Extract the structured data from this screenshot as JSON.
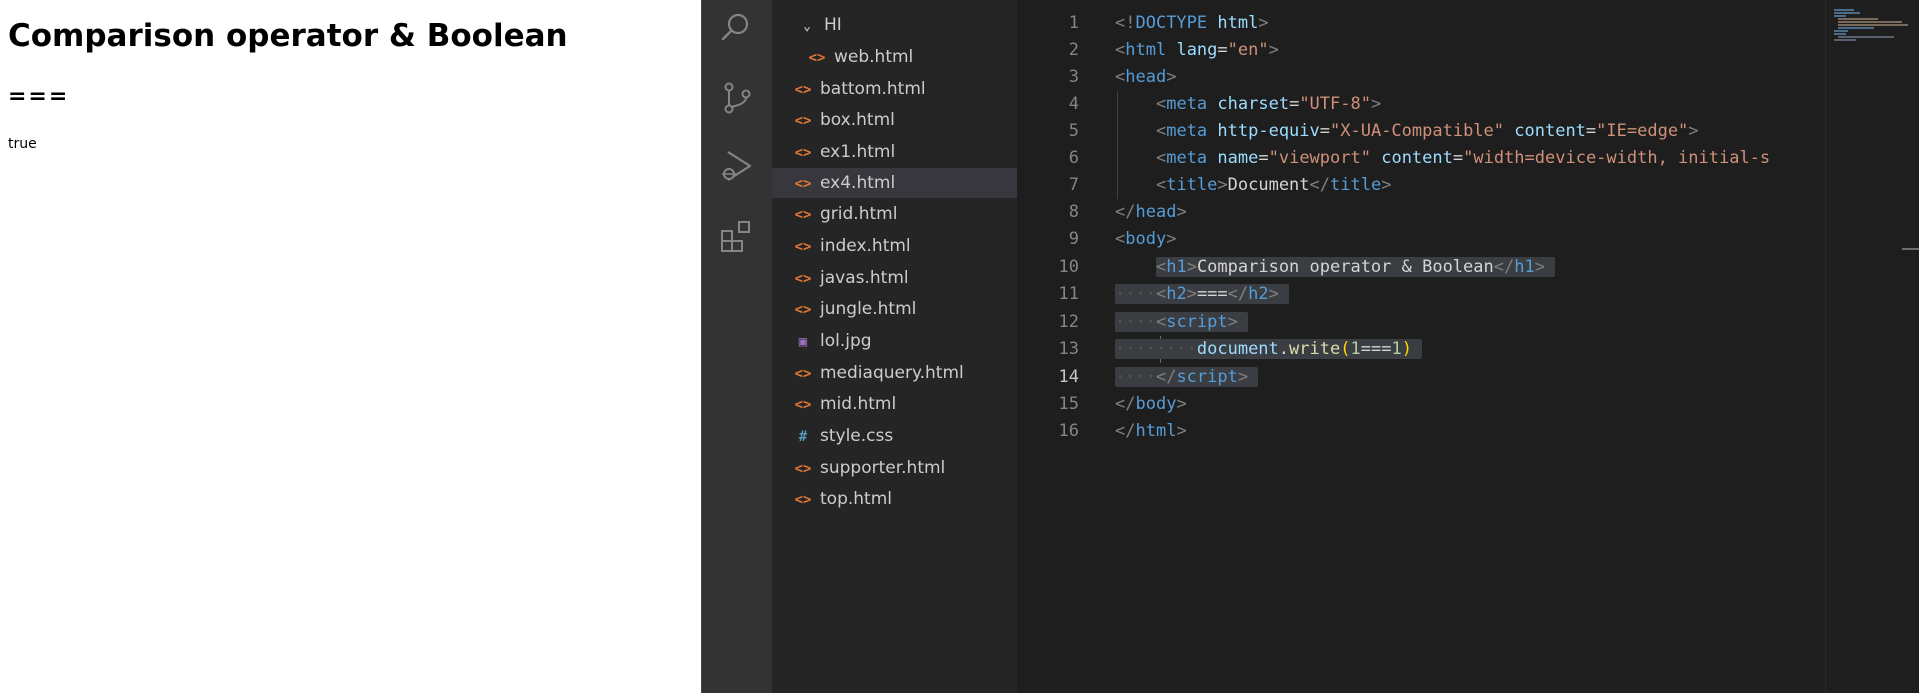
{
  "preview": {
    "h1": "Comparison operator & Boolean",
    "h2": "===",
    "output": "true"
  },
  "explorer": {
    "items": [
      {
        "label": "HI",
        "icon": "chevron-down-icon",
        "selected": false
      },
      {
        "label": "web.html",
        "icon": "html-file-icon",
        "selected": false
      },
      {
        "label": "battom.html",
        "icon": "html-file-icon",
        "selected": false
      },
      {
        "label": "box.html",
        "icon": "html-file-icon",
        "selected": false
      },
      {
        "label": "ex1.html",
        "icon": "html-file-icon",
        "selected": false
      },
      {
        "label": "ex4.html",
        "icon": "html-file-icon",
        "selected": true
      },
      {
        "label": "grid.html",
        "icon": "html-file-icon",
        "selected": false
      },
      {
        "label": "index.html",
        "icon": "html-file-icon",
        "selected": false
      },
      {
        "label": "javas.html",
        "icon": "html-file-icon",
        "selected": false
      },
      {
        "label": "jungle.html",
        "icon": "html-file-icon",
        "selected": false
      },
      {
        "label": "lol.jpg",
        "icon": "image-file-icon",
        "selected": false
      },
      {
        "label": "mediaquery.html",
        "icon": "html-file-icon",
        "selected": false
      },
      {
        "label": "mid.html",
        "icon": "html-file-icon",
        "selected": false
      },
      {
        "label": "style.css",
        "icon": "css-file-icon",
        "selected": false
      },
      {
        "label": "supporter.html",
        "icon": "html-file-icon",
        "selected": false
      },
      {
        "label": "top.html",
        "icon": "html-file-icon",
        "selected": false
      }
    ]
  },
  "activity_bar": [
    "search-icon",
    "source-control-icon",
    "run-debug-icon",
    "extensions-icon"
  ],
  "editor": {
    "active_line": 14,
    "line_numbers": [
      "1",
      "2",
      "3",
      "4",
      "5",
      "6",
      "7",
      "8",
      "9",
      "10",
      "11",
      "12",
      "13",
      "14",
      "15",
      "16"
    ],
    "code": {
      "doctype": "DOCTYPE",
      "html_kw": "html",
      "html": "html",
      "lang": "lang",
      "lang_val": "\"en\"",
      "head": "head",
      "meta": "meta",
      "charset": "charset",
      "charset_val": "\"UTF-8\"",
      "http_equiv": "http-equiv",
      "http_equiv_val": "\"X-UA-Compatible\"",
      "content": "content",
      "content_val": "\"IE=edge\"",
      "name": "name",
      "name_val": "\"viewport\"",
      "viewport_val": "\"width=device-width, initial-s",
      "title": "title",
      "title_text": "Document",
      "body": "body",
      "h1": "h1",
      "h1_text": "Comparison operator & Boolean",
      "h2": "h2",
      "h2_text": "===",
      "script": "script",
      "document": "document",
      "write": "write",
      "num1": "1",
      "op": "===",
      "num2": "1"
    }
  },
  "colors": {
    "editor_bg": "#1e1e1e",
    "sidebar_bg": "#252526",
    "activity_bg": "#333333",
    "tag": "#569cd6",
    "attribute": "#9cdcfe",
    "string": "#ce9178",
    "function": "#dcdcaa",
    "html_icon": "#e37933",
    "css_icon": "#519aba"
  }
}
